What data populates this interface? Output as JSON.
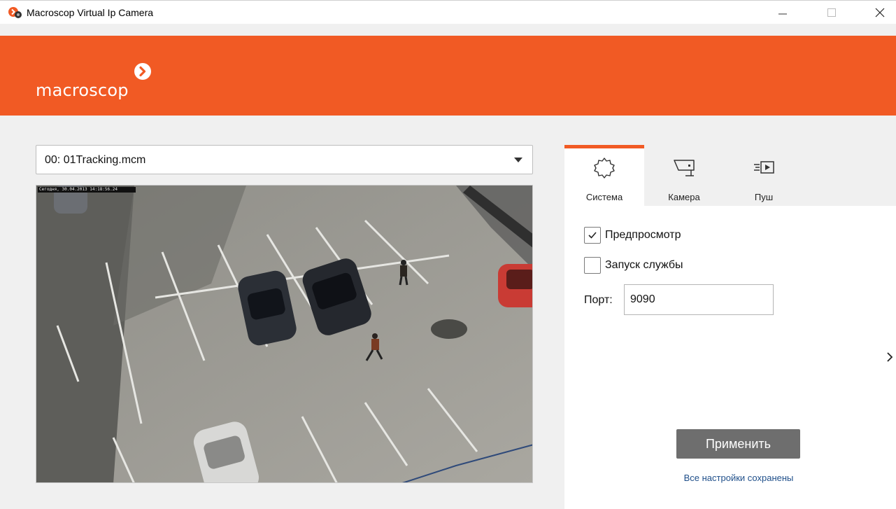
{
  "window": {
    "title": "Macroscop Virtual Ip Camera"
  },
  "banner": {
    "logo_text": "macroscop",
    "brand_color": "#f15a24"
  },
  "source_select": {
    "selected": "00: 01Tracking.mcm"
  },
  "video": {
    "osd_text": "Сегодня, 30.04.2013 14:18:56.24"
  },
  "tabs": [
    {
      "label": "Система",
      "icon": "gear-outline-icon",
      "active": true
    },
    {
      "label": "Камера",
      "icon": "camera-icon",
      "active": false
    },
    {
      "label": "Пуш",
      "icon": "push-icon",
      "active": false
    }
  ],
  "settings": {
    "preview_label": "Предпросмотр",
    "preview_checked": true,
    "service_label": "Запуск службы",
    "service_checked": false,
    "port_label": "Порт:",
    "port_value": "9090",
    "apply_label": "Применить",
    "status": "Все настройки сохранены"
  }
}
